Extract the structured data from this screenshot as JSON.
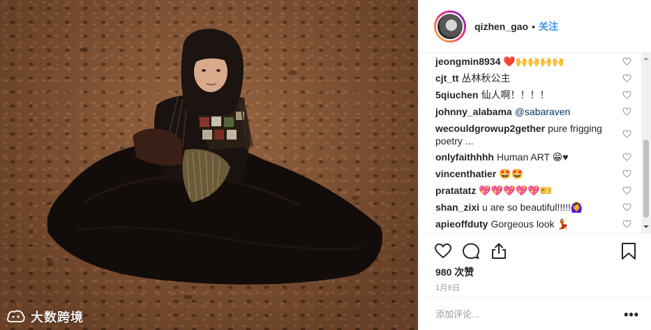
{
  "post": {
    "username": "qizhen_gao",
    "separator": "•",
    "follow_label": "关注",
    "likes_count": "980",
    "likes_suffix": "次赞",
    "date": "1月8日"
  },
  "comments": [
    {
      "user": "jeongmin8934",
      "text": "❤️🙌🙌🙌🙌"
    },
    {
      "user": "cjt_tt",
      "text": "丛林秋公主"
    },
    {
      "user": "5qiuchen",
      "text": "仙人啊！！！！"
    },
    {
      "user": "johnny_alabama",
      "text": "",
      "mention": "@sabaraven"
    },
    {
      "user": "wecouldgrowup2gether",
      "text": "pure frigging poetry ..."
    },
    {
      "user": "onlyfaithhhh",
      "text": "Human ART 😁♥"
    },
    {
      "user": "vincenthatier",
      "text": "🤩🤩"
    },
    {
      "user": "pratatatz",
      "text": "💖💖💖💖💖🎫"
    },
    {
      "user": "shan_zixi",
      "text": "u are so beautiful!!!!!🙆‍♀️"
    },
    {
      "user": "apieoffduty",
      "text": "Gorgeous look 💃"
    }
  ],
  "add_comment": {
    "placeholder": "添加评论...",
    "more_label": "•••"
  },
  "watermark": {
    "text": "大数跨境"
  },
  "colors": {
    "accent": "#3897f0",
    "text": "#262626",
    "muted": "#999999",
    "divider": "#efefef"
  },
  "icons": [
    "heart-icon",
    "comment-icon",
    "share-icon",
    "bookmark-icon",
    "small-heart-icon"
  ]
}
